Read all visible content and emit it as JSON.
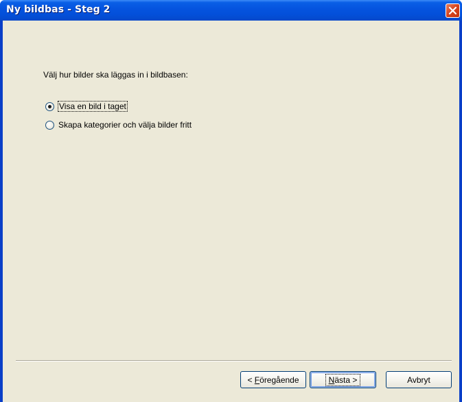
{
  "window": {
    "title": "Ny bildbas - Steg 2"
  },
  "content": {
    "prompt": "Välj hur bilder ska läggas in i bildbasen:",
    "options": [
      {
        "label": "Visa en bild i taget",
        "checked": true
      },
      {
        "label": "Skapa kategorier och välja bilder fritt",
        "checked": false
      }
    ]
  },
  "buttons": {
    "back": {
      "prefix": "< ",
      "mnemonic": "F",
      "rest": "öregående"
    },
    "next": {
      "mnemonic": "N",
      "rest": "ästa >"
    },
    "cancel": "Avbryt"
  },
  "colors": {
    "titlebar": "#0553de",
    "client": "#ece9d8",
    "close": "#d6431c"
  }
}
